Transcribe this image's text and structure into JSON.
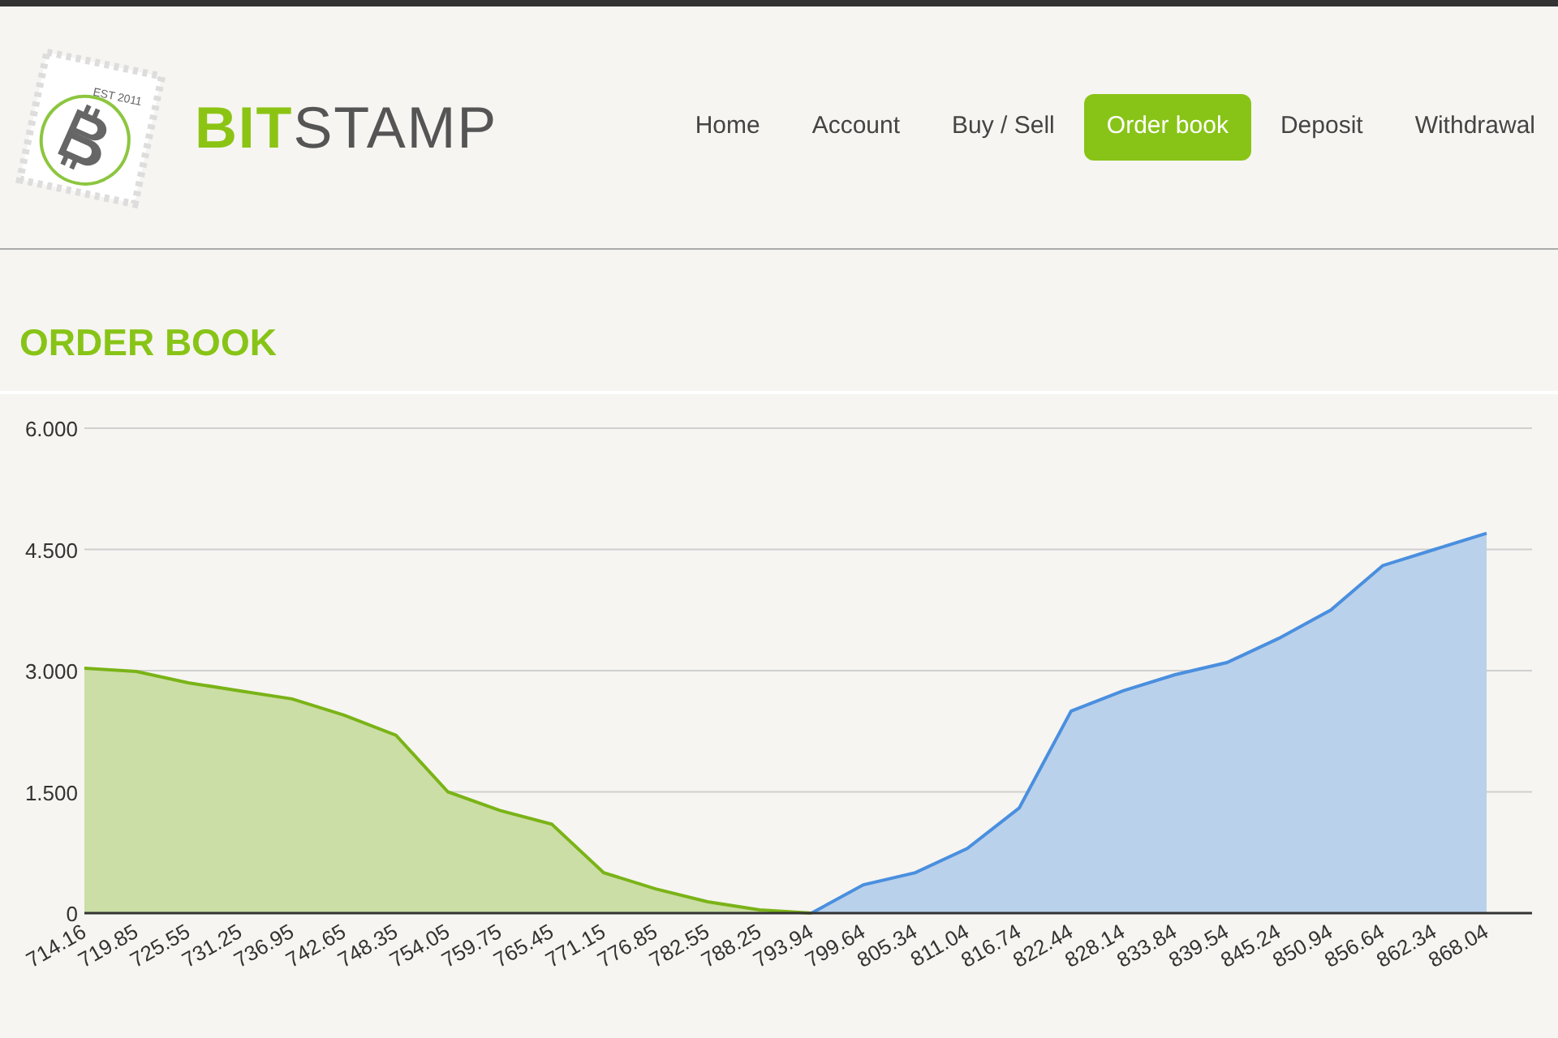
{
  "logo": {
    "stamp_text": "EST 2011",
    "word_accent": "BIT",
    "word_rest": "STAMP"
  },
  "nav": [
    {
      "label": "Home",
      "selected": false
    },
    {
      "label": "Account",
      "selected": false
    },
    {
      "label": "Buy / Sell",
      "selected": false
    },
    {
      "label": "Order book",
      "selected": true
    },
    {
      "label": "Deposit",
      "selected": false
    },
    {
      "label": "Withdrawal",
      "selected": false
    }
  ],
  "heading": "ORDER BOOK",
  "chart_data": {
    "type": "area",
    "x": [
      "714.16",
      "719.85",
      "725.55",
      "731.25",
      "736.95",
      "742.65",
      "748.35",
      "754.05",
      "759.75",
      "765.45",
      "771.15",
      "776.85",
      "782.55",
      "788.25",
      "793.94",
      "799.64",
      "805.34",
      "811.04",
      "816.74",
      "822.44",
      "828.14",
      "833.84",
      "839.54",
      "845.24",
      "850.94",
      "856.64",
      "862.34",
      "868.04"
    ],
    "ylim": [
      0,
      6
    ],
    "grid": true,
    "yticks": [
      {
        "value": 0,
        "label": "0"
      },
      {
        "value": 1.5,
        "label": "1.500"
      },
      {
        "value": 3,
        "label": "3.000"
      },
      {
        "value": 4.5,
        "label": "4.500"
      },
      {
        "value": 6,
        "label": "6.000"
      }
    ],
    "series": [
      {
        "color": "#7ab317",
        "values": [
          3.03,
          2.99,
          2.85,
          2.75,
          2.65,
          2.45,
          2.2,
          1.5,
          1.27,
          1.1,
          0.5,
          0.3,
          0.14,
          0.04,
          0,
          null,
          null,
          null,
          null,
          null,
          null,
          null,
          null,
          null,
          null,
          null,
          null,
          null
        ]
      },
      {
        "color": "#4a8fdf",
        "values": [
          null,
          null,
          null,
          null,
          null,
          null,
          null,
          null,
          null,
          null,
          null,
          null,
          null,
          null,
          0,
          0.35,
          0.5,
          0.8,
          1.3,
          2.5,
          2.75,
          2.95,
          3.1,
          3.4,
          3.75,
          4.3,
          4.5,
          4.7
        ]
      }
    ]
  }
}
